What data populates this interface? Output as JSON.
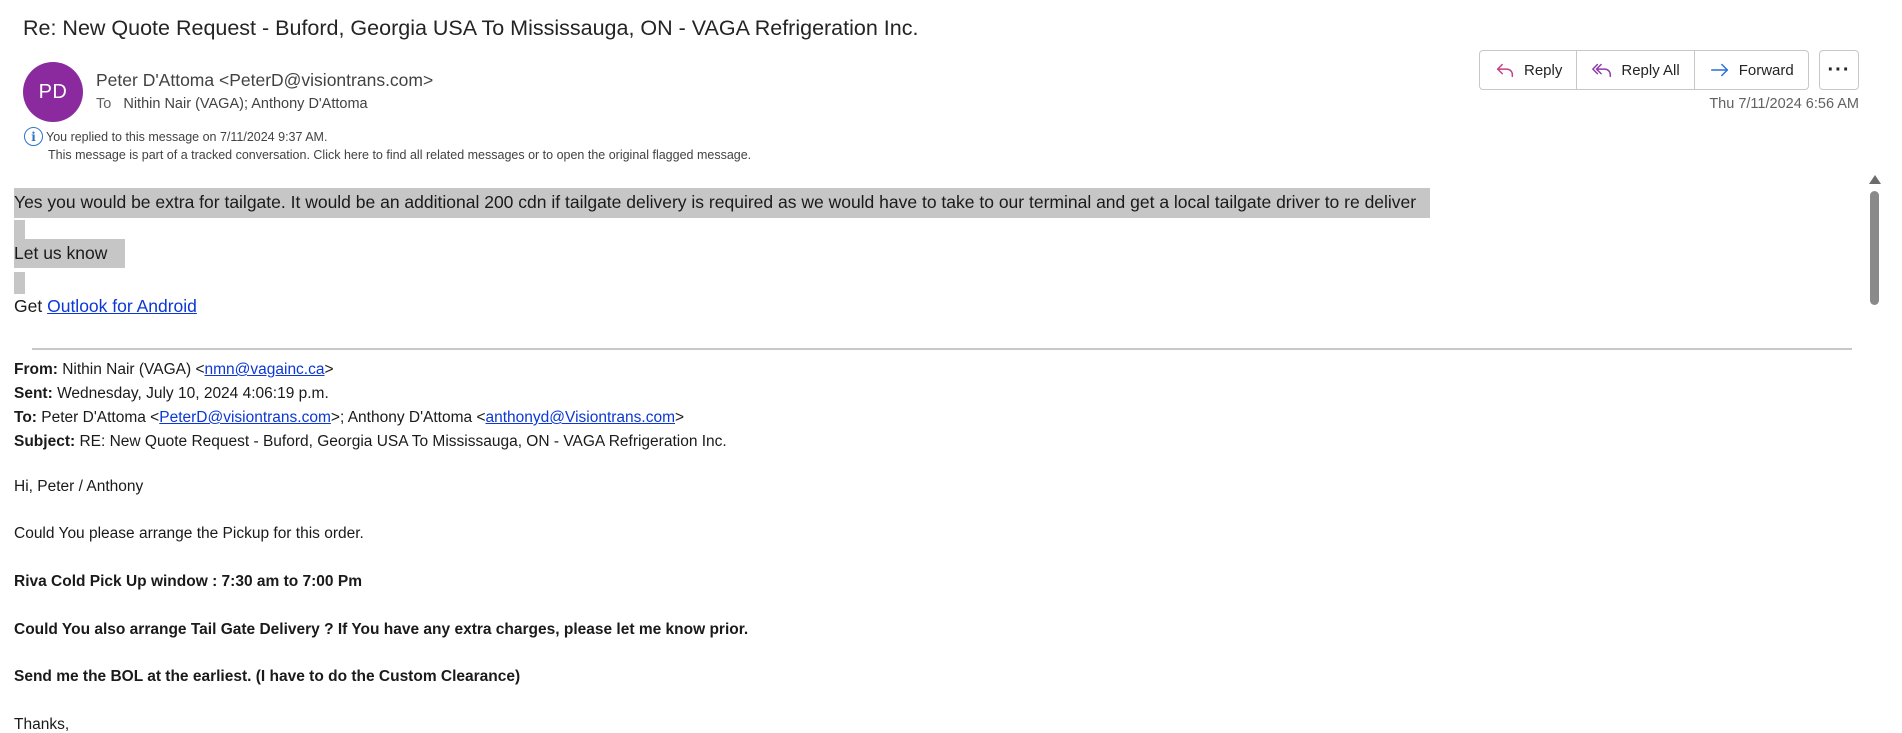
{
  "email": {
    "subject": "Re: New Quote Request - Buford, Georgia USA To Mississauga, ON - VAGA Refrigeration Inc.",
    "avatar_initials": "PD",
    "avatar_color": "#8a2a9e",
    "sender": "Peter D'Attoma <PeterD@visiontrans.com>",
    "to_label": "To",
    "to_recipients": "Nithin Nair (VAGA); Anthony D'Attoma",
    "replied_notice": "You replied to this message on 7/11/2024 9:37 AM.",
    "tracked_notice": "This message is part of a tracked conversation. Click here to find all related messages or to open the original flagged message.",
    "date": "Thu 7/11/2024 6:56 AM"
  },
  "actions": {
    "reply": "Reply",
    "reply_all": "Reply All",
    "forward": "Forward",
    "more": "···"
  },
  "body": {
    "para1": "Yes you would be extra for tailgate. It would be an additional 200 cdn if tailgate delivery is required as we would have to take to our terminal and get a local tailgate driver to re deliver",
    "para2": "Let us know",
    "get_prefix": "Get",
    "outlook_link": "Outlook for Android"
  },
  "quoted_header": {
    "from_label": "From:",
    "from_name": "Nithin Nair (VAGA) <",
    "from_email": "nmn@vagainc.ca",
    "from_close": ">",
    "sent_label": "Sent:",
    "sent_value": "Wednesday, July 10, 2024 4:06:19 p.m.",
    "to_label": "To:",
    "to_name1": "Peter D'Attoma <",
    "to_email1": "PeterD@visiontrans.com",
    "to_sep": ">; Anthony D'Attoma <",
    "to_email2": "anthonyd@Visiontrans.com",
    "to_close": ">",
    "subject_label": "Subject:",
    "subject_value": "RE: New Quote Request - Buford, Georgia USA To Mississauga, ON - VAGA Refrigeration Inc."
  },
  "quoted_body": {
    "greeting": "Hi, Peter / Anthony",
    "line1": "Could You please arrange the Pickup for this order.",
    "line2": "Riva Cold Pick Up window : 7:30 am to 7:00 Pm",
    "line3": "Could You also arrange Tail Gate Delivery ? If You have any extra charges, please let me know prior.",
    "line4": "Send me the BOL at the earliest. (I have to do the Custom Clearance)",
    "closing": "Thanks,"
  }
}
